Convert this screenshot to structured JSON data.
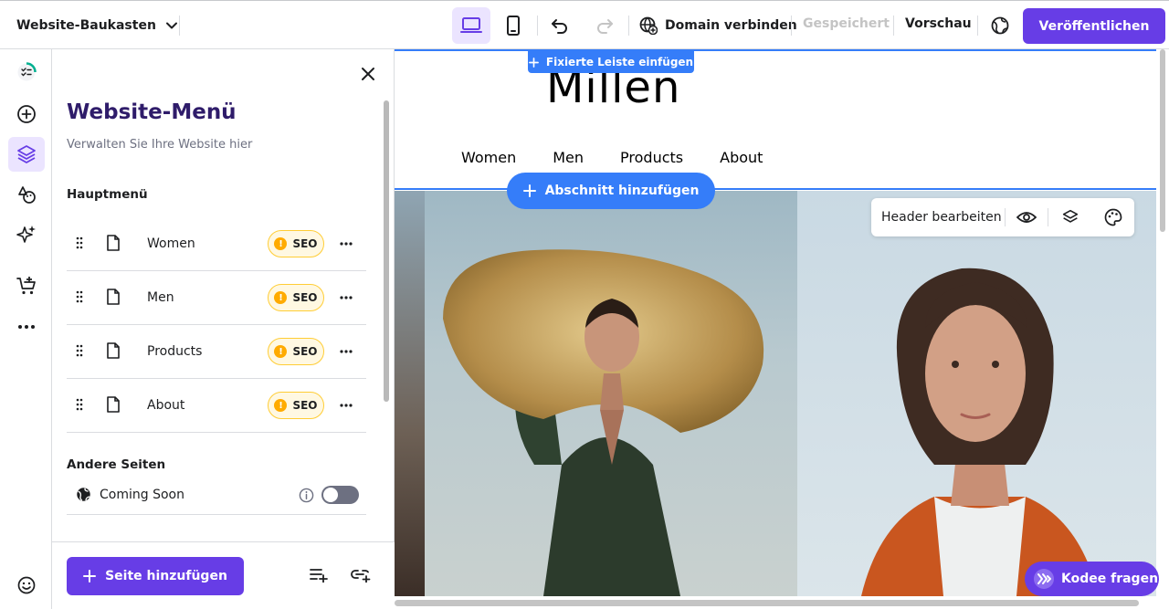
{
  "topbar": {
    "site_name": "Website-Baukasten",
    "domain_label": "Domain verbinden",
    "saved_label": "Gespeichert",
    "preview_label": "Vorschau",
    "publish_label": "Veröffentlichen"
  },
  "panel": {
    "title": "Website-Menü",
    "subtitle": "Verwalten Sie Ihre Website hier",
    "main_menu_label": "Hauptmenü",
    "items": [
      {
        "label": "Women",
        "badge": "SEO"
      },
      {
        "label": "Men",
        "badge": "SEO"
      },
      {
        "label": "Products",
        "badge": "SEO"
      },
      {
        "label": "About",
        "badge": "SEO"
      }
    ],
    "other_pages_label": "Andere Seiten",
    "other_pages": [
      {
        "label": "Coming Soon",
        "enabled": false
      }
    ],
    "add_page_label": "Seite hinzufügen"
  },
  "canvas": {
    "sticky_bar_label": "Fixierte Leiste einfügen",
    "logo": "Millen",
    "nav": [
      "Women",
      "Men",
      "Products",
      "About"
    ],
    "add_section_label": "Abschnitt hinzufügen",
    "edit_header_label": "Header bearbeiten",
    "kodee_label": "Kodee fragen"
  },
  "colors": {
    "accent": "#673de6",
    "selection": "#357df9",
    "seo_warning": "#ffab00"
  }
}
